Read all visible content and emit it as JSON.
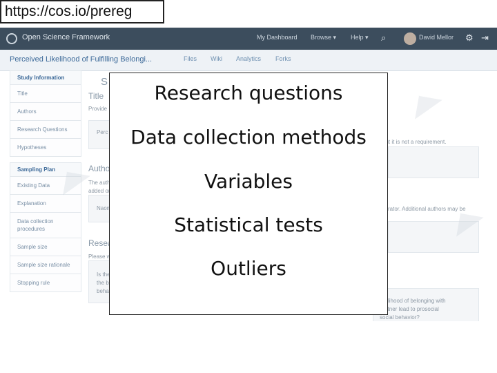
{
  "url_label": "https://cos.io/prereg",
  "osf": {
    "brand": "Open Science Framework",
    "nav": {
      "dashboard": "My Dashboard",
      "browse": "Browse ▾",
      "help": "Help ▾",
      "user": "David Mellor"
    },
    "project_title": "Perceived Likelihood of Fulfilling Belongi...",
    "project_tabs": [
      "Files",
      "Wiki",
      "Analytics",
      "Forks"
    ],
    "sidebar": {
      "study_head": "Study Information",
      "study_items": [
        "Title",
        "Authors",
        "Research Questions",
        "Hypotheses"
      ],
      "sampling_head": "Sampling Plan",
      "sampling_items": [
        "Existing Data",
        "Explanation",
        "Data collection procedures",
        "Sample size",
        "Sample size rationale",
        "Stopping rule"
      ]
    },
    "form": {
      "s_title": "S",
      "title_label": "Title",
      "title_help": "Provide",
      "title_help_tail": "but it is not a requirement.",
      "title_value": "Perc",
      "authors_label": "Author",
      "authors_help": "The autho",
      "authors_help2": "added on",
      "authors_help_tail": "istrator. Additional authors may be",
      "authors_value": "Naom",
      "research_label": "Resea",
      "research_help": "Please w",
      "research_value_1": "Is the",
      "research_value_2": "the b",
      "research_value_3": "beha",
      "research_tail_1": "likelihood of belonging with",
      "research_tail_2": "partner lead to prosocial",
      "research_tail_3": "social behavior?"
    }
  },
  "overlay": {
    "lines": [
      "Research questions",
      "Data collection methods",
      "Variables",
      "Statistical tests",
      "Outliers"
    ]
  }
}
